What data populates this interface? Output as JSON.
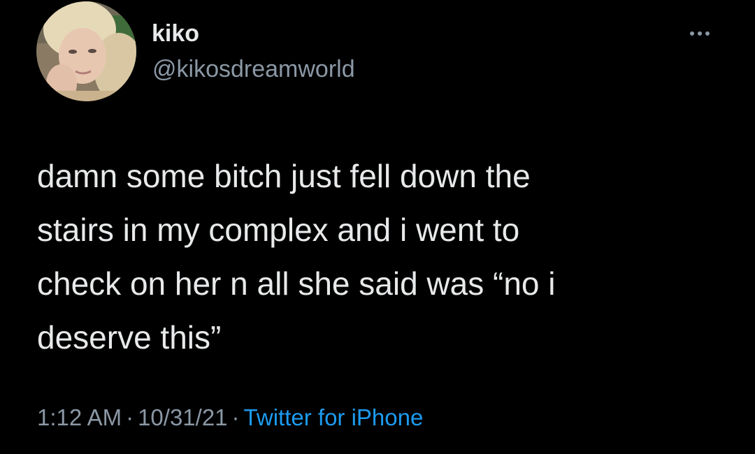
{
  "tweet": {
    "author": {
      "display_name": "kiko",
      "handle": "@kikosdreamworld"
    },
    "text_lines": [
      "damn some bitch just fell down the",
      "stairs in my complex and i went to",
      "check on her n all she said was “no i",
      "deserve this”"
    ],
    "time": "1:12 AM",
    "date": "10/31/21",
    "separator": "·",
    "source": "Twitter for iPhone"
  },
  "icons": {
    "more": "more-options-icon"
  },
  "colors": {
    "background": "#000000",
    "primary_text": "#e7e9ea",
    "secondary_text": "#8b98a5",
    "link": "#1d9bf0"
  }
}
